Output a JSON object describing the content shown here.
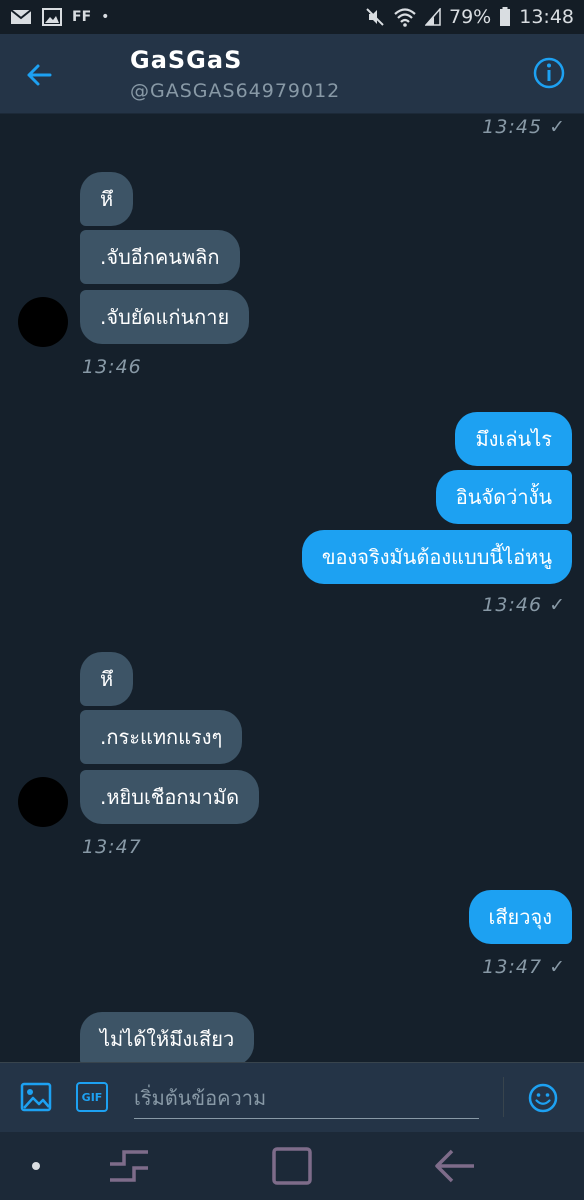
{
  "status_bar": {
    "notification_icons": [
      "mail-icon",
      "image-icon",
      "ff-icon",
      "dot-icon"
    ],
    "ff_label": "FF",
    "battery": "79%",
    "time": "13:48"
  },
  "header": {
    "title": "GaSGaS",
    "handle": "@GASGAS64979012"
  },
  "messages": [
    {
      "type": "time",
      "side": "out",
      "text": "13:45 ✓"
    },
    {
      "type": "bubble",
      "side": "in",
      "text": "หึ"
    },
    {
      "type": "bubble",
      "side": "in",
      "text": ".จับอีกคนพลิก"
    },
    {
      "type": "bubble",
      "side": "in",
      "text": ".จับยัดแก่นกาย"
    },
    {
      "type": "time",
      "side": "in",
      "text": "13:46"
    },
    {
      "type": "bubble",
      "side": "out",
      "text": "มึงเล่นไร"
    },
    {
      "type": "bubble",
      "side": "out",
      "text": "อินจัดว่างั้น"
    },
    {
      "type": "bubble",
      "side": "out",
      "text": "ของจริงมันต้องแบบนี้ไอ่หนู"
    },
    {
      "type": "time",
      "side": "out",
      "text": "13:46 ✓"
    },
    {
      "type": "bubble",
      "side": "in",
      "text": "หึ"
    },
    {
      "type": "bubble",
      "side": "in",
      "text": ".กระแทกแรงๆ"
    },
    {
      "type": "bubble",
      "side": "in",
      "text": ".หยิบเชือกมามัด"
    },
    {
      "type": "time",
      "side": "in",
      "text": "13:47"
    },
    {
      "type": "bubble",
      "side": "out",
      "text": "เสียวจุง"
    },
    {
      "type": "time",
      "side": "out",
      "text": "13:47 ✓"
    },
    {
      "type": "bubble",
      "side": "in",
      "text": "ไม่ได้ให้มึงเสียว"
    }
  ],
  "composer": {
    "placeholder": "เริ่มต้นข้อความ",
    "gif_label": "GIF"
  },
  "colors": {
    "background": "#15202b",
    "header": "#243447",
    "incoming_bubble": "#3d5466",
    "outgoing_bubble": "#1da1f2",
    "accent": "#1da1f2",
    "muted_text": "#8899a6"
  }
}
